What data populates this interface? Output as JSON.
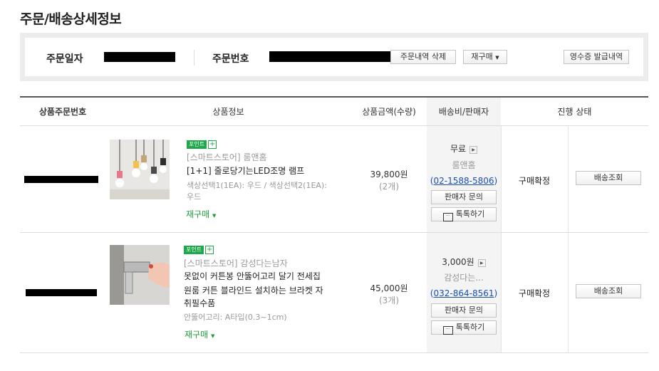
{
  "page": {
    "title": "주문/배송상세정보"
  },
  "order_info": {
    "date_label": "주문일자",
    "number_label": "주문번호",
    "delete_button": "주문내역 삭제",
    "rebuy_button": "재구매",
    "receipt_button": "영수증 발급내역"
  },
  "table": {
    "headers": [
      "상품주문번호",
      "상품정보",
      "상품금액(수량)",
      "배송비/판매자",
      "진행 상태"
    ],
    "rows": [
      {
        "badge": "포인트",
        "store": "[스마트스토어] 룸앤홈",
        "name_lines": [
          "[1+1] 줄로당기는LED조명 램프"
        ],
        "option_lines": [
          "색상선택1(1EA): 우드 / 색상선택2(1EA):",
          "우드"
        ],
        "rebuy": "재구매",
        "price": "39,800원",
        "qty": "(2개)",
        "shipping": "무료",
        "seller": "룸앤홈",
        "phone": "02-1588-5806",
        "inquiry_button": "판매자 문의",
        "talk_button": "톡톡하기",
        "status": "구매확정",
        "track_button": "배송조회"
      },
      {
        "badge": "포인트",
        "store": "[스마트스토어] 감성다는남자",
        "name_lines": [
          "못없이 커튼봉 안뚫어고리 달기 전세집",
          "원룸 커튼 블라인드 설치하는 브라켓 자",
          "취필수품"
        ],
        "option_lines": [
          "안뚫어고리: A타입(0.3~1cm)"
        ],
        "rebuy": "재구매",
        "price": "45,000원",
        "qty": "(3개)",
        "shipping": "3,000원",
        "seller": "감성다는...",
        "phone": "032-864-8561",
        "inquiry_button": "판매자 문의",
        "talk_button": "톡톡하기",
        "status": "구매확정",
        "track_button": "배송조회"
      }
    ]
  }
}
